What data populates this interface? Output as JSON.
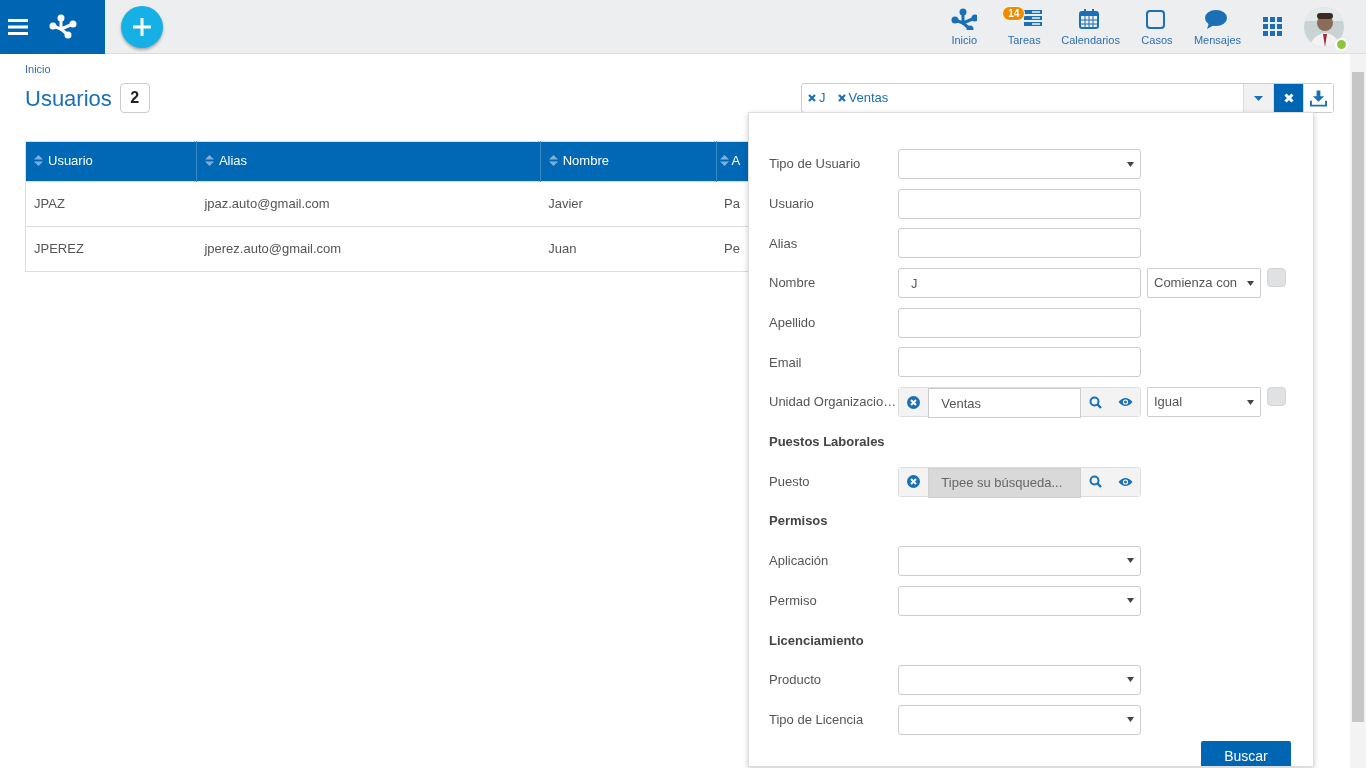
{
  "topbar": {
    "nav": [
      {
        "kind": "home",
        "label": "Inicio"
      },
      {
        "kind": "tasks",
        "label": "Tareas",
        "badge": "14"
      },
      {
        "kind": "calendar",
        "label": "Calendarios"
      },
      {
        "kind": "cases",
        "label": "Casos"
      },
      {
        "kind": "messages",
        "label": "Mensajes"
      }
    ],
    "user": {
      "online": true
    }
  },
  "breadcrumb": [
    "Inicio"
  ],
  "page": {
    "title": "Usuarios",
    "count": "2"
  },
  "filter_tags": [
    {
      "label": "J"
    },
    {
      "label": "Ventas"
    }
  ],
  "table": {
    "columns": [
      "Usuario",
      "Alias",
      "Nombre",
      "A"
    ],
    "rows": [
      [
        "JPAZ",
        "jpaz.auto@gmail.com",
        "Javier",
        "Pa"
      ],
      [
        "JPEREZ",
        "jperez.auto@gmail.com",
        "Juan",
        "Pe"
      ]
    ]
  },
  "search_panel": {
    "items": [
      {
        "kind": "select",
        "label": "Tipo de Usuario"
      },
      {
        "kind": "text",
        "label": "Usuario"
      },
      {
        "kind": "text",
        "label": "Alias"
      },
      {
        "kind": "text",
        "label": "Nombre",
        "value": "J",
        "operator": "Comienza con",
        "checked": false
      },
      {
        "kind": "text",
        "label": "Apellido"
      },
      {
        "kind": "text",
        "label": "Email"
      },
      {
        "kind": "lookup",
        "label": "Unidad Organizacio…",
        "value": "Ventas",
        "operator": "Igual",
        "checked": false,
        "disabled": false
      },
      {
        "kind": "section",
        "label": "Puestos Laborales"
      },
      {
        "kind": "lookup",
        "label": "Puesto",
        "placeholder": "Tipee su búsqueda...",
        "disabled": true
      },
      {
        "kind": "section",
        "label": "Permisos"
      },
      {
        "kind": "select",
        "label": "Aplicación"
      },
      {
        "kind": "select",
        "label": "Permiso"
      },
      {
        "kind": "section",
        "label": "Licenciamiento"
      },
      {
        "kind": "select",
        "label": "Producto"
      },
      {
        "kind": "select",
        "label": "Tipo de Licencia"
      }
    ],
    "submit": "Buscar"
  }
}
